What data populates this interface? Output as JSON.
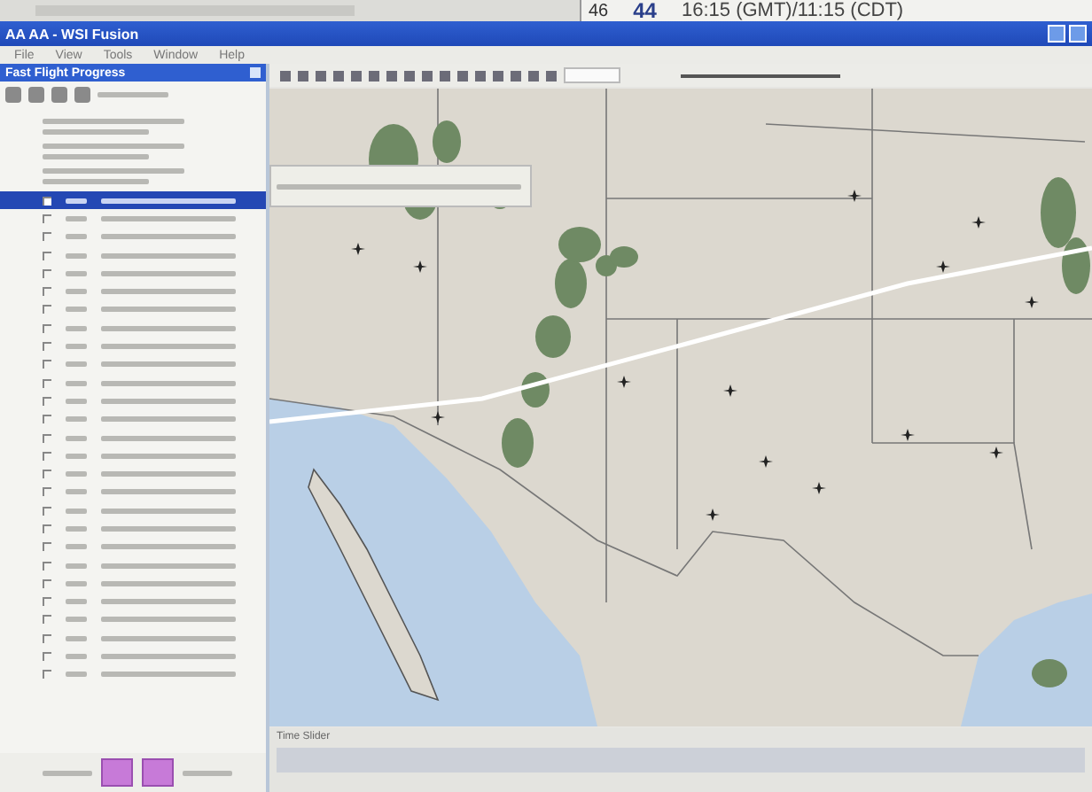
{
  "top_strip": {
    "value_1": "46",
    "value_2": "44",
    "time": "16:15 (GMT)/11:15 (CDT)"
  },
  "window": {
    "title": "AA AA - WSI Fusion"
  },
  "menu": [
    "File",
    "View",
    "Tools",
    "Window",
    "Help"
  ],
  "panel": {
    "title": "Fast Flight Progress",
    "rows": [
      {
        "selected": true,
        "checked": true
      },
      {
        "selected": false,
        "checked": false
      },
      {
        "selected": false,
        "checked": false
      },
      {
        "selected": false,
        "checked": false
      },
      {
        "selected": false,
        "checked": false
      },
      {
        "selected": false,
        "checked": false
      },
      {
        "selected": false,
        "checked": false
      },
      {
        "selected": false,
        "checked": false
      },
      {
        "selected": false,
        "checked": false
      },
      {
        "selected": false,
        "checked": false
      },
      {
        "selected": false,
        "checked": false
      },
      {
        "selected": false,
        "checked": false
      },
      {
        "selected": false,
        "checked": false
      },
      {
        "selected": false,
        "checked": false
      },
      {
        "selected": false,
        "checked": false
      },
      {
        "selected": false,
        "checked": false
      },
      {
        "selected": false,
        "checked": false
      },
      {
        "selected": false,
        "checked": false
      },
      {
        "selected": false,
        "checked": false
      },
      {
        "selected": false,
        "checked": false
      },
      {
        "selected": false,
        "checked": false
      },
      {
        "selected": false,
        "checked": false
      },
      {
        "selected": false,
        "checked": false
      },
      {
        "selected": false,
        "checked": false
      },
      {
        "selected": false,
        "checked": false
      },
      {
        "selected": false,
        "checked": false
      },
      {
        "selected": false,
        "checked": false
      }
    ]
  },
  "time_slider": {
    "title": "Time Slider"
  }
}
